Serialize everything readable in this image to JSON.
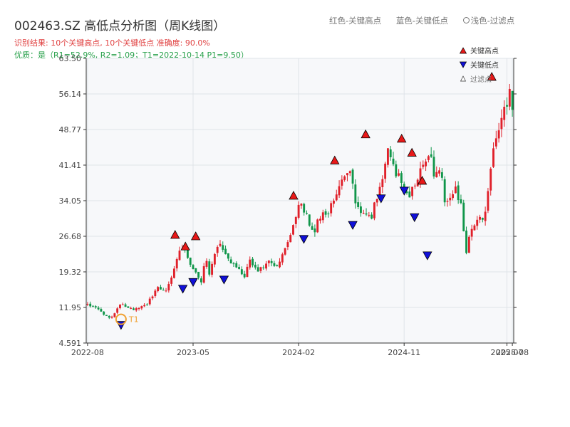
{
  "header": {
    "title": "002463.SZ 高低点分析图（周K线图）",
    "result_text": "识别结果: 10个关键高点, 10个关键低点   准确度: 90.0%",
    "quality_text": "优质：是（R1=52.9%, R2=1.09；T1=2022-10-14 P1=9.50）"
  },
  "top_legend": {
    "red": "红色-关键高点",
    "blue": "蓝色-关键低点",
    "light": "浅色-过滤点"
  },
  "colors": {
    "up": "#e0202a",
    "down": "#10964a",
    "high_marker": "#e81818",
    "low_marker": "#1010d8",
    "t1_ring": "#f0a030",
    "plot_bg": "#f7f8fa",
    "grid": "#dfe3e8"
  },
  "chart_data": {
    "type": "candlestick",
    "y_ticks": [
      "4.591",
      "11.95",
      "19.32",
      "26.68",
      "34.05",
      "41.41",
      "48.77",
      "56.14",
      "63.50"
    ],
    "ylim": [
      4.591,
      63.5
    ],
    "x_ticks": [
      {
        "label": "2022-08",
        "index": 0
      },
      {
        "label": "2023-05",
        "index": 39
      },
      {
        "label": "2024-02",
        "index": 78
      },
      {
        "label": "2024-11",
        "index": 117
      },
      {
        "label": "2025-07",
        "index": 155
      },
      {
        "label": "2025-08",
        "index": 157
      }
    ],
    "n_bars": 158,
    "anchors": [
      [
        0,
        12.5
      ],
      [
        5,
        11.5
      ],
      [
        7,
        10.2
      ],
      [
        9,
        9.5
      ],
      [
        11,
        11.4
      ],
      [
        13,
        12.6
      ],
      [
        18,
        11.5
      ],
      [
        23,
        12.5
      ],
      [
        27,
        16.0
      ],
      [
        31,
        15.5
      ],
      [
        34,
        21.0
      ],
      [
        37,
        25.0
      ],
      [
        39,
        22.0
      ],
      [
        42,
        19.0
      ],
      [
        44,
        16.8
      ],
      [
        46,
        23.0
      ],
      [
        47,
        18.5
      ],
      [
        49,
        22.0
      ],
      [
        51,
        25.5
      ],
      [
        55,
        22.0
      ],
      [
        58,
        20.0
      ],
      [
        61,
        18.5
      ],
      [
        63,
        21.5
      ],
      [
        66,
        19.5
      ],
      [
        70,
        21.5
      ],
      [
        74,
        20.5
      ],
      [
        76,
        23.0
      ],
      [
        78,
        26.0
      ],
      [
        81,
        31.5
      ],
      [
        83,
        33.5
      ],
      [
        86,
        29.5
      ],
      [
        88,
        27.5
      ],
      [
        91,
        32.0
      ],
      [
        93,
        31.0
      ],
      [
        97,
        36.0
      ],
      [
        100,
        38.5
      ],
      [
        102,
        40.5
      ],
      [
        104,
        33.0
      ],
      [
        107,
        31.5
      ],
      [
        110,
        30.2
      ],
      [
        112,
        34.0
      ],
      [
        115,
        39.5
      ],
      [
        117,
        45.0
      ],
      [
        120,
        39.5
      ],
      [
        123,
        37.0
      ],
      [
        125,
        35.0
      ],
      [
        128,
        39.0
      ],
      [
        130,
        42.0
      ],
      [
        133,
        44.5
      ],
      [
        135,
        38.0
      ],
      [
        137,
        42.0
      ],
      [
        139,
        33.0
      ],
      [
        141,
        35.0
      ],
      [
        143,
        36.5
      ],
      [
        145,
        33.0
      ],
      [
        147,
        23.5
      ],
      [
        149,
        28.0
      ],
      [
        152,
        31.0
      ],
      [
        154,
        30.0
      ],
      [
        156,
        38.0
      ],
      [
        158,
        47.0
      ],
      [
        160,
        50.0
      ],
      [
        162,
        53.0
      ],
      [
        164,
        56.0
      ],
      [
        165,
        52.0
      ]
    ],
    "key_highs": [
      {
        "i": 34,
        "price": 25.8
      },
      {
        "i": 38,
        "price": 23.4
      },
      {
        "i": 42,
        "price": 25.5
      },
      {
        "i": 80,
        "price": 33.9
      },
      {
        "i": 96,
        "price": 41.2
      },
      {
        "i": 108,
        "price": 46.6
      },
      {
        "i": 122,
        "price": 45.7
      },
      {
        "i": 126,
        "price": 42.8
      },
      {
        "i": 130,
        "price": 37.0
      },
      {
        "i": 157,
        "price": 58.5
      }
    ],
    "key_lows": [
      {
        "i": 13,
        "price": 9.5
      },
      {
        "i": 37,
        "price": 17.0
      },
      {
        "i": 41,
        "price": 18.4
      },
      {
        "i": 53,
        "price": 18.9
      },
      {
        "i": 84,
        "price": 27.3
      },
      {
        "i": 103,
        "price": 30.2
      },
      {
        "i": 114,
        "price": 35.7
      },
      {
        "i": 123,
        "price": 37.3
      },
      {
        "i": 127,
        "price": 31.8
      },
      {
        "i": 132,
        "price": 23.9
      }
    ],
    "t1_label": "T1",
    "t1_index": 13,
    "t1_price": 9.5,
    "legend": {
      "key_high": "关键高点",
      "key_low": "关键低点",
      "filtered": "过滤点"
    }
  }
}
